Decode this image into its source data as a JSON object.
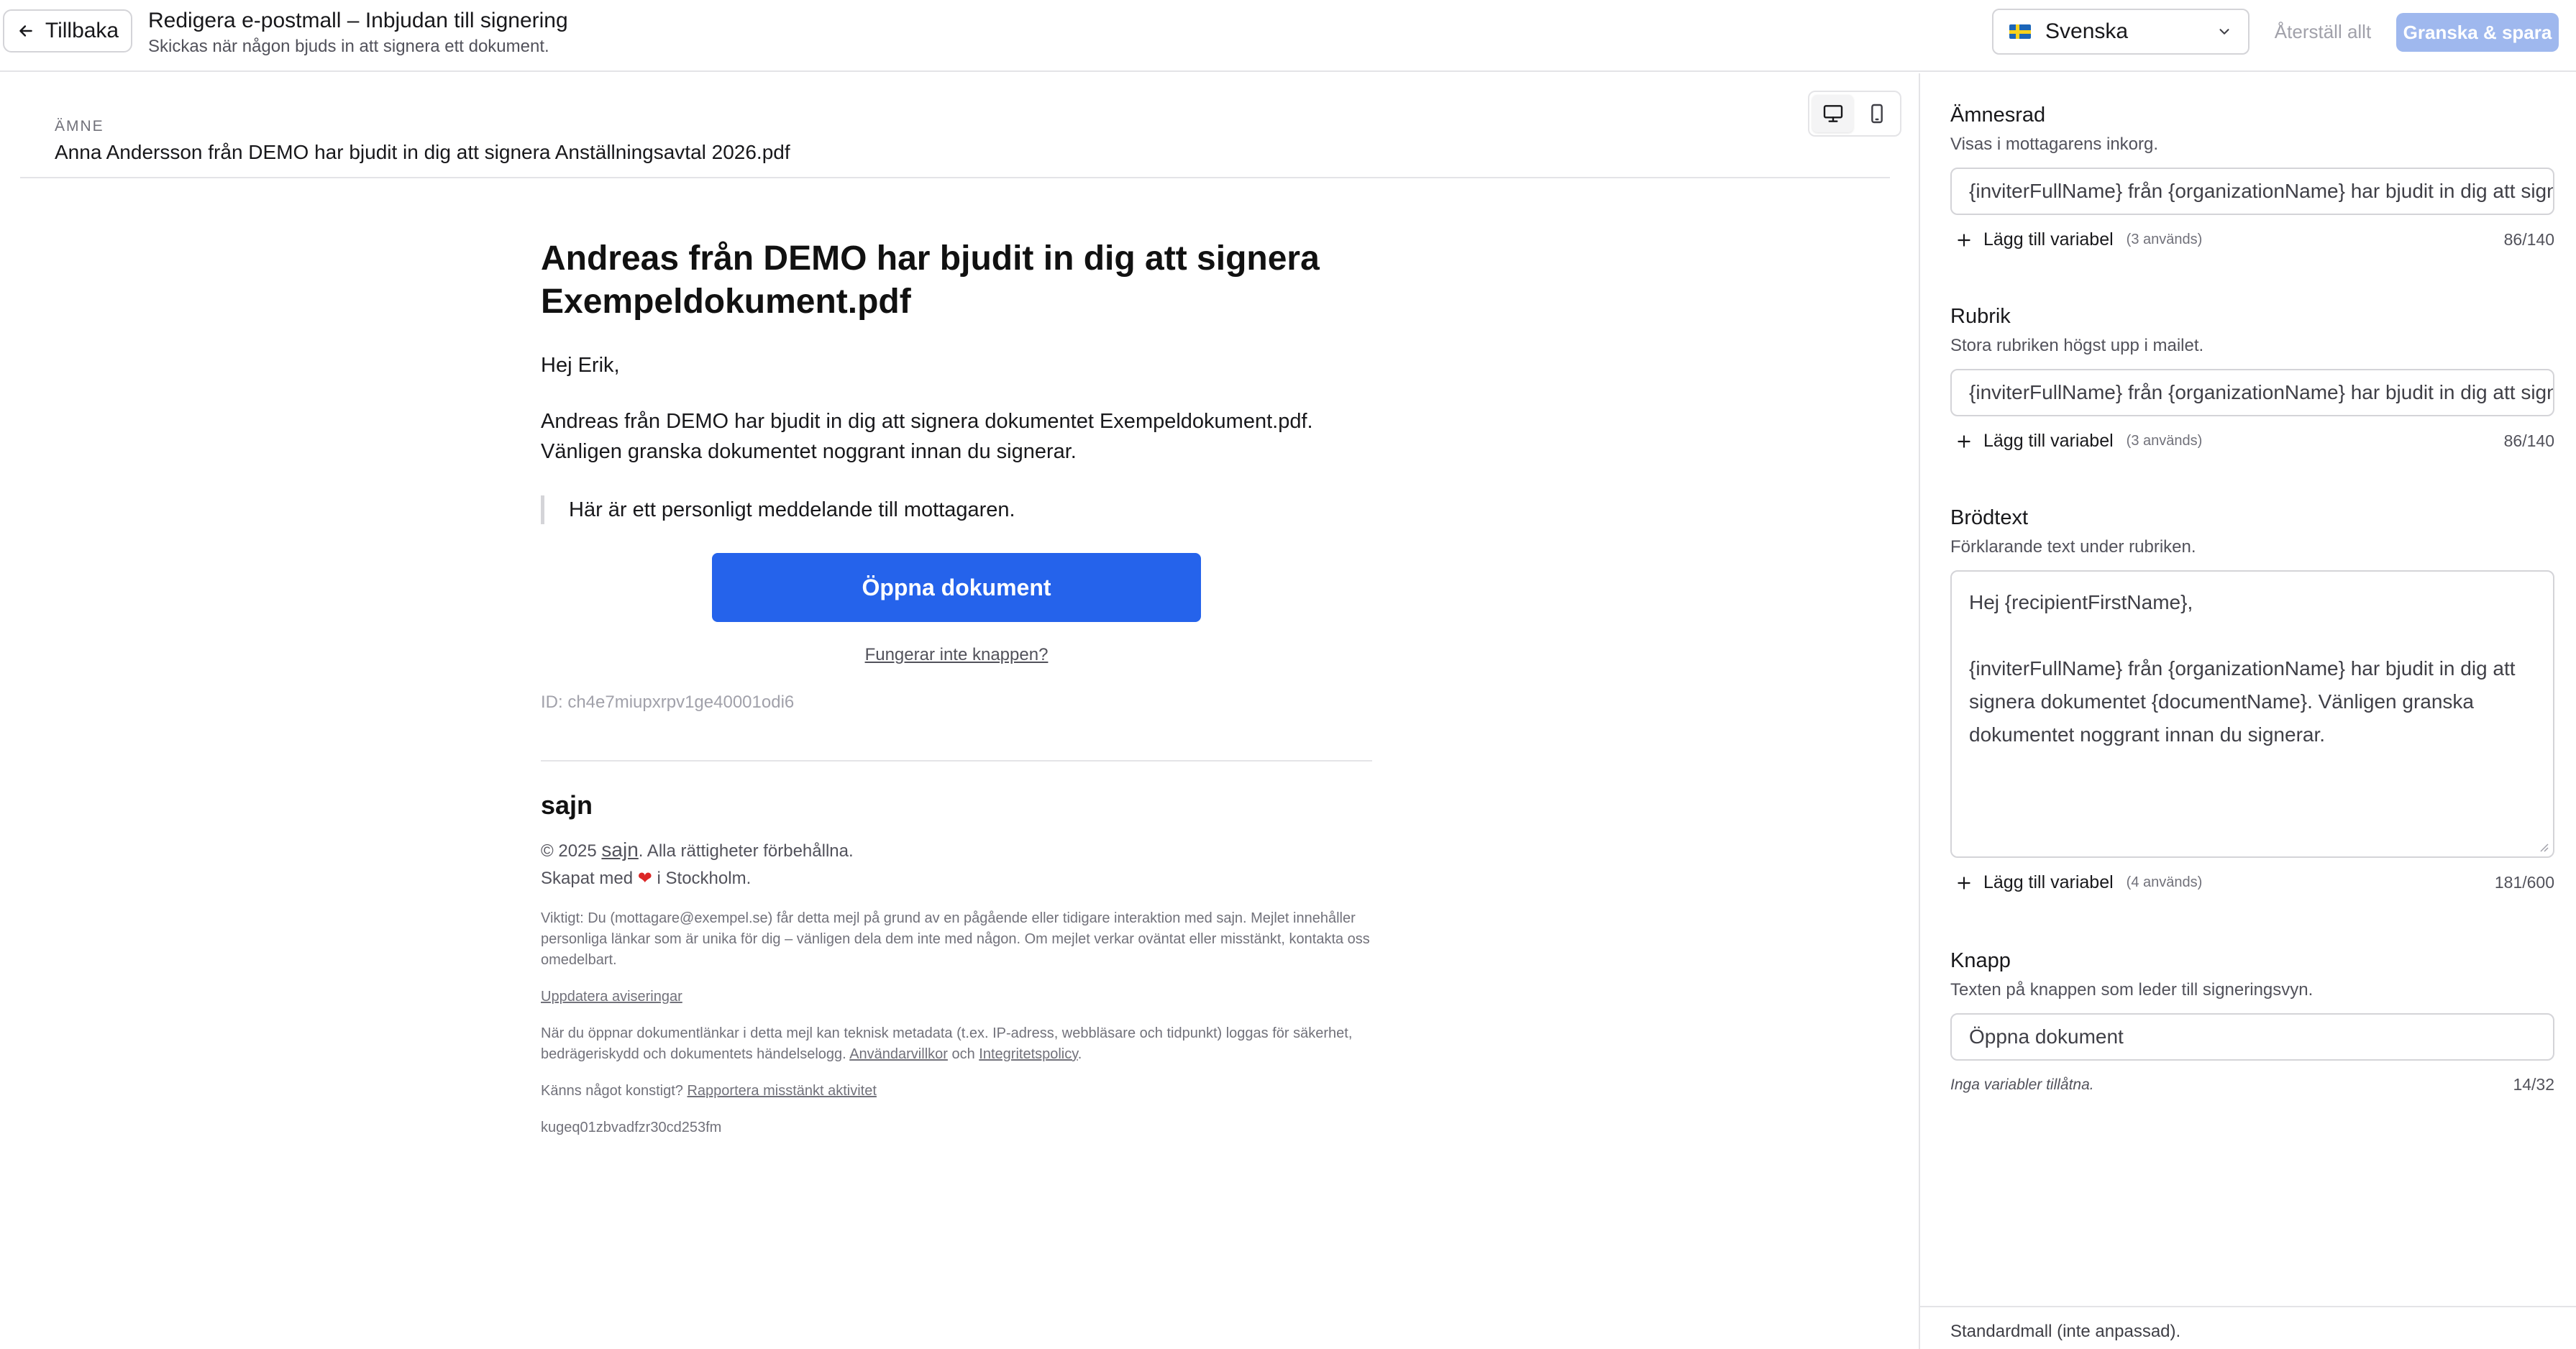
{
  "header": {
    "back_label": "Tillbaka",
    "title": "Redigera e-postmall – Inbjudan till signering",
    "subtitle": "Skickas när någon bjuds in att signera ett dokument.",
    "language": "Svenska",
    "reset_label": "Återställ allt",
    "review_label": "Granska & spara"
  },
  "preview": {
    "subject_label": "ÄMNE",
    "subject_value": "Anna Andersson från DEMO har bjudit in dig att signera Anställningsavtal 2026.pdf",
    "email": {
      "heading": "Andreas från DEMO har bjudit in dig att signera Exempeldokument.pdf",
      "greeting": "Hej Erik,",
      "body": "Andreas från DEMO har bjudit in dig att signera dokumentet Exempeldokument.pdf. Vänligen granska dokumentet noggrant innan du signerar.",
      "quote": "Här är ett personligt meddelande till mottagaren.",
      "button": "Öppna dokument",
      "fallback_link": "Fungerar inte knappen?",
      "id_text": "ID: ch4e7miupxrpv1ge40001odi6",
      "brand": "sajn",
      "copyright_prefix": "© 2025",
      "copyright_brand": "sajn",
      "copyright_suffix": ". Alla rättigheter förbehållna.",
      "made_in_prefix": "Skapat med",
      "made_in_suffix": "i Stockholm.",
      "legal_1": "Viktigt: Du (mottagare@exempel.se) får detta mejl på grund av en pågående eller tidigare interaktion med sajn. Mejlet innehåller personliga länkar som är unika för dig – vänligen dela dem inte med någon. Om mejlet verkar oväntat eller misstänkt, kontakta oss omedelbart.",
      "update_notifications": "Uppdatera aviseringar",
      "legal_2_text": "När du öppnar dokumentlänkar i detta mejl kan teknisk metadata (t.ex. IP-adress, webbläsare och tidpunkt) loggas för säkerhet, bedrägeriskydd och dokumentets händelselogg.",
      "terms_link": "Användarvillkor",
      "and_word": "och",
      "privacy_link": "Integritetspolicy",
      "suspicious_prefix": "Känns något konstigt?",
      "report_link": "Rapportera misstänkt aktivitet",
      "tracking_id": "kugeq01zbvadfzr30cd253fm"
    }
  },
  "panel": {
    "subject": {
      "label": "Ämnesrad",
      "help": "Visas i mottagarens inkorg.",
      "value": "{inviterFullName} från {organizationName} har bjudit in dig att signera {documentName}",
      "add_var": "Lägg till variabel",
      "usage": "(3 används)",
      "counter": "86/140"
    },
    "heading": {
      "label": "Rubrik",
      "help": "Stora rubriken högst upp i mailet.",
      "value": "{inviterFullName} från {organizationName} har bjudit in dig att signera {documentName}",
      "add_var": "Lägg till variabel",
      "usage": "(3 används)",
      "counter": "86/140"
    },
    "body": {
      "label": "Brödtext",
      "help": "Förklarande text under rubriken.",
      "line1": "Hej {recipientFirstName},",
      "line2": "{inviterFullName} från {organizationName} har bjudit in dig att signera dokumentet {documentName}. Vänligen granska dokumentet noggrant innan du signerar.",
      "add_var": "Lägg till variabel",
      "usage": "(4 används)",
      "counter": "181/600"
    },
    "button": {
      "label": "Knapp",
      "help": "Texten på knappen som leder till signeringsvyn.",
      "value": "Öppna dokument",
      "no_vars": "Inga variabler tillåtna.",
      "counter": "14/32"
    },
    "footer": "Standardmall (inte anpassad)."
  },
  "colors": {
    "primary": "#2563eb",
    "primary_disabled": "#9fb8ee",
    "border": "#e4e4e7",
    "muted_text": "#71717a"
  },
  "icons": {
    "back": "arrow-left-icon",
    "language_flag": "sweden-flag-icon",
    "chevron": "chevron-down-icon",
    "desktop": "monitor-icon",
    "mobile": "smartphone-icon",
    "add": "plus-icon",
    "heart": "heart-icon"
  }
}
